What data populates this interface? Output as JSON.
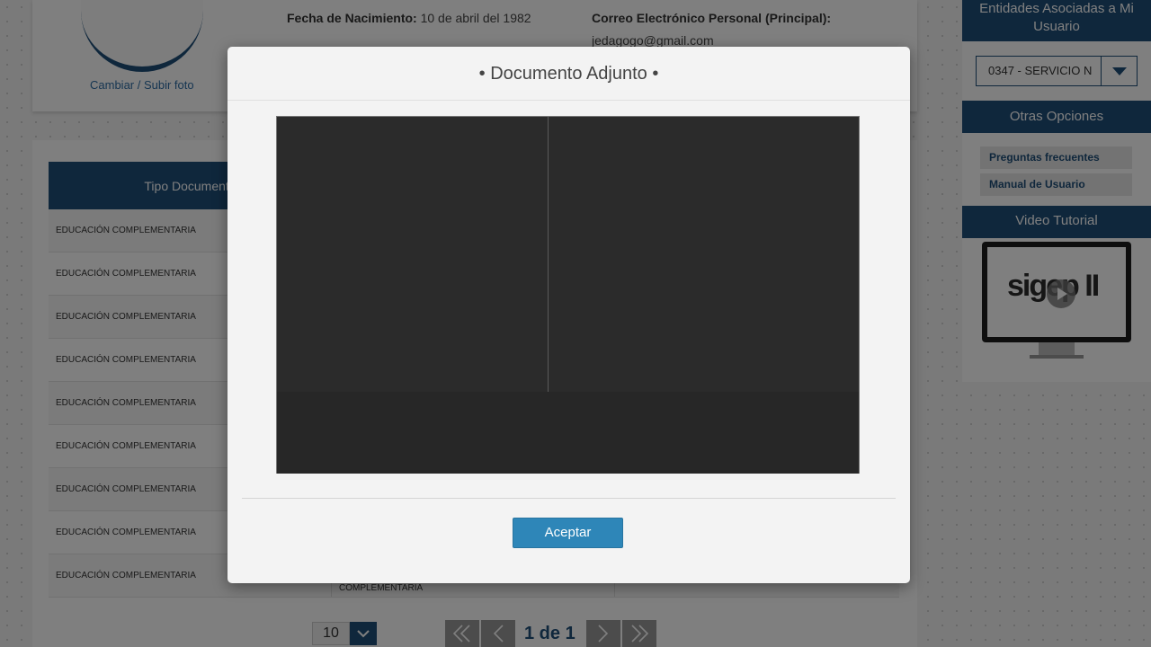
{
  "profile": {
    "change_photo": "Cambiar / Subir foto",
    "birth_label": "Fecha de Nacimiento:",
    "birth_value": "10 de abril del 1982",
    "email_label": "Correo Electrónico Personal (Principal):",
    "email_value": "jedagogo@gmail.com"
  },
  "documents": {
    "header": "Tipo Documento",
    "rows": [
      "EDUCACIÓN COMPLEMENTARIA",
      "EDUCACIÓN COMPLEMENTARIA",
      "EDUCACIÓN COMPLEMENTARIA",
      "EDUCACIÓN COMPLEMENTARIA",
      "EDUCACIÓN COMPLEMENTARIA",
      "EDUCACIÓN COMPLEMENTARIA",
      "EDUCACIÓN COMPLEMENTARIA",
      "EDUCACIÓN COMPLEMENTARIA",
      "EDUCACIÓN COMPLEMENTARIA"
    ],
    "last_row_col2": "COMPLEMENTARIA"
  },
  "pager": {
    "page_size": "10",
    "page_text": "1 de 1"
  },
  "sidebar": {
    "entities_title": "Entidades Asociadas a Mi Usuario",
    "entity_value": "0347 - SERVICIO N",
    "other_title": "Otras Opciones",
    "faq": "Preguntas frecuentes",
    "manual": "Manual de Usuario",
    "video_title": "Video Tutorial",
    "video_brand": "sigep II"
  },
  "modal": {
    "title": "• Documento Adjunto •",
    "accept": "Aceptar"
  },
  "colors": {
    "primary": "#1f4e79",
    "accept": "#2e86b8"
  }
}
